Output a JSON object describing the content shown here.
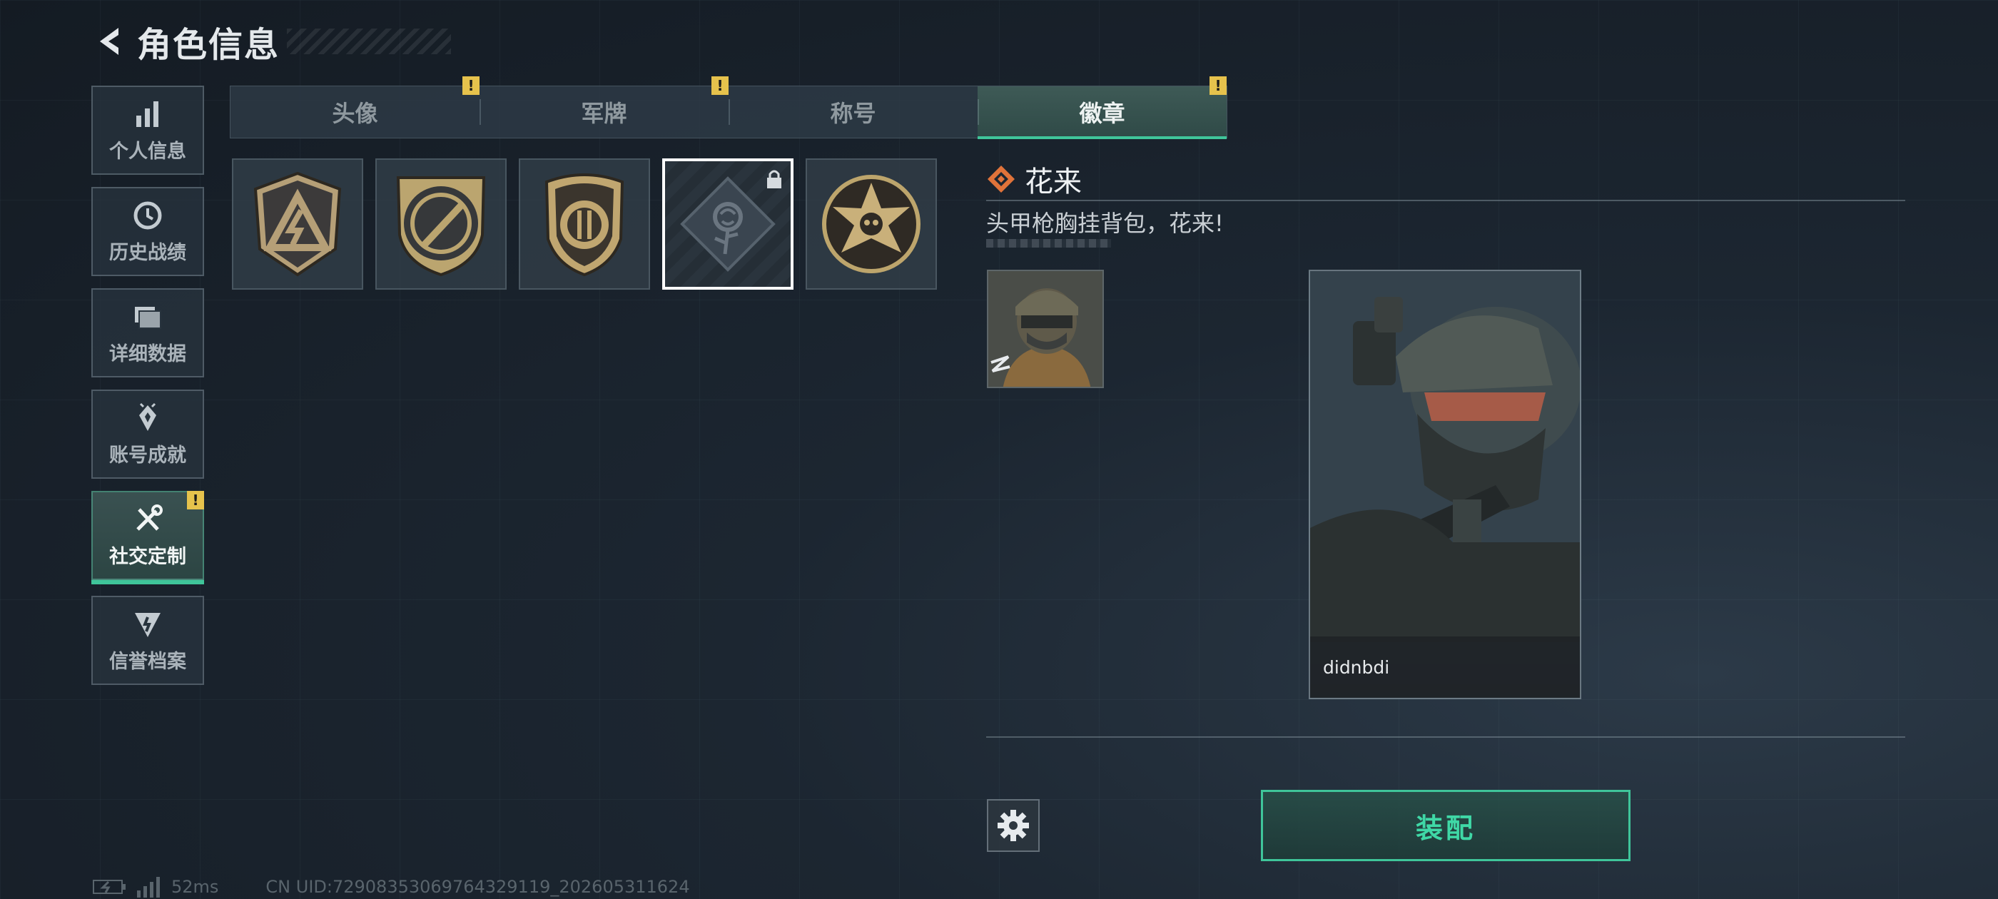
{
  "header": {
    "title": "角色信息"
  },
  "sidebar": {
    "items": [
      {
        "label": "个人信息",
        "icon": "bar-chart-icon"
      },
      {
        "label": "历史战绩",
        "icon": "history-icon"
      },
      {
        "label": "详细数据",
        "icon": "folder-icon"
      },
      {
        "label": "账号成就",
        "icon": "achievement-icon"
      },
      {
        "label": "社交定制",
        "icon": "tools-icon",
        "active": true,
        "alert": "!"
      },
      {
        "label": "信誉档案",
        "icon": "reputation-icon"
      }
    ]
  },
  "tabs": [
    {
      "label": "头像",
      "alert": "!"
    },
    {
      "label": "军牌",
      "alert": "!"
    },
    {
      "label": "称号"
    },
    {
      "label": "徽章",
      "active": true,
      "alert": "!"
    }
  ],
  "badges": [
    {
      "name": "triangle-bolt-badge"
    },
    {
      "name": "knife-badge"
    },
    {
      "name": "shield-badge"
    },
    {
      "name": "rose-badge",
      "selected": true,
      "locked": true
    },
    {
      "name": "star-skull-badge"
    }
  ],
  "detail": {
    "title": "花来",
    "description": "头甲枪胸挂背包，花来!",
    "player_name": "didnbdi",
    "equip_label": "装配"
  },
  "status": {
    "ping": "52ms",
    "uid": "CN UID:7290835306976432911​9_202605311624"
  },
  "colors": {
    "accent": "#3fc59a",
    "alert": "#e6c24c",
    "title_icon": "#e0733a"
  }
}
